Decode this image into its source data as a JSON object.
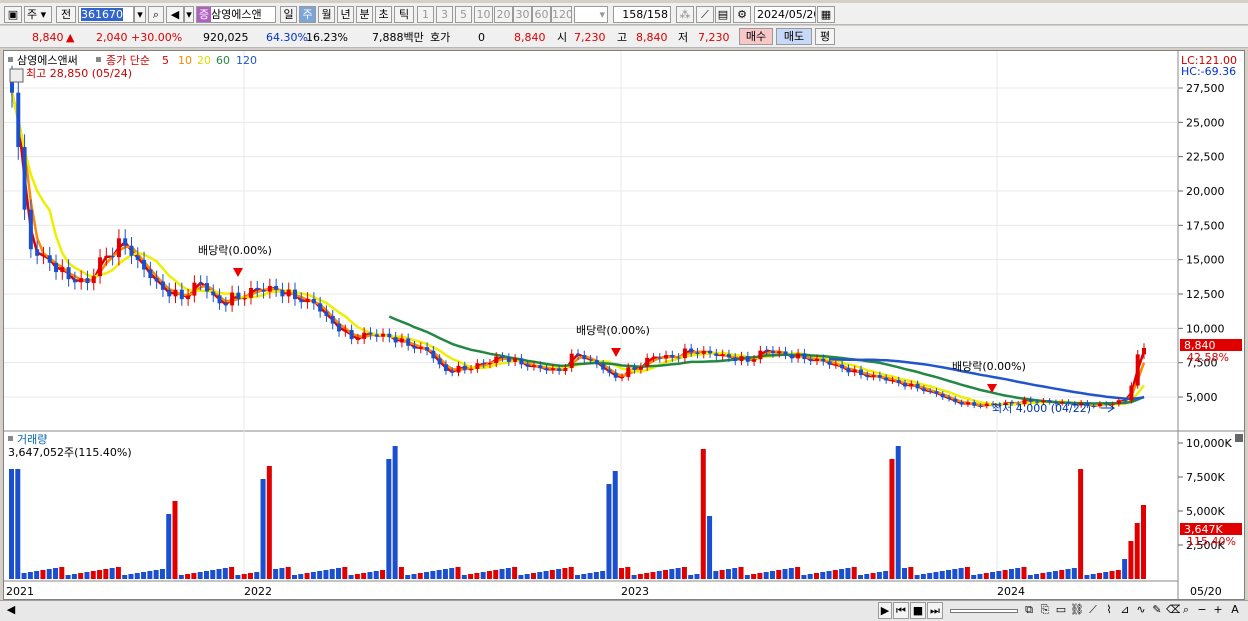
{
  "toolbar": {
    "period_type": "주",
    "prev_label": "전",
    "code": "361670",
    "stock_name": "삼영에스앤",
    "stock_badge": "증",
    "periods": [
      "일",
      "주",
      "월",
      "년",
      "분",
      "초",
      "틱"
    ],
    "active_period": "주",
    "intervals": [
      "1",
      "3",
      "5",
      "10",
      "20",
      "30",
      "60",
      "120"
    ],
    "page_count": "158",
    "page_total": "/158",
    "date": "2024/05/20"
  },
  "quote": {
    "price": "8,840",
    "arrow": "▲",
    "change": "2,040",
    "change_pct": "+30.00%",
    "volume": "920,025",
    "vol_ratio": "64.30%",
    "turnover": "16.23%",
    "amount": "7,888백만",
    "hoga_label": "호가",
    "hoga_value": "0",
    "hoga_price": "8,840",
    "open_label": "시",
    "open": "7,230",
    "high_label": "고",
    "high": "8,840",
    "low_label": "저",
    "low": "7,230",
    "buy_label": "매수",
    "sell_label": "매도",
    "flat_label": "평"
  },
  "chart": {
    "legend_name": "삼영에스앤써",
    "ma_label": "종가 단순",
    "ma_periods": [
      "5",
      "10",
      "20",
      "60",
      "120"
    ],
    "ma_colors": [
      "#dd0000",
      "#ff8800",
      "#eeee00",
      "#228844",
      "#2255cc"
    ],
    "high_annot": "최고 28,850 (05/24)",
    "low_annot": "최저 4,000 (04/22)",
    "dividend_label": "배당락(0.00%)",
    "lc": "LC:121.00",
    "hc": "HC:-69.36",
    "price_ticks": [
      "27,500",
      "25,000",
      "22,500",
      "20,000",
      "17,500",
      "15,000",
      "12,500",
      "10,000",
      "7,500",
      "5,000"
    ],
    "price_tag": "8,840",
    "price_tag_pct": "42.58%",
    "volume_title": "거래량",
    "volume_value": "3,647,052주(115.40%)",
    "volume_ticks": [
      "10,000K",
      "7,500K",
      "5,000K",
      "2,500K"
    ],
    "volume_tag": "3,647K",
    "volume_tag_pct": "115.40%",
    "x_labels": [
      "2021",
      "2022",
      "2023",
      "2024"
    ],
    "x_last": "05/20"
  },
  "colors": {
    "up": "#e00000",
    "down": "#1a4fd0",
    "accent": "#7aa5d6"
  },
  "chart_data": {
    "type": "candlestick",
    "x_years": [
      "2021",
      "2022",
      "2023",
      "2024"
    ],
    "close_approx": [
      28000,
      16000,
      15000,
      14000,
      13500,
      15500,
      16500,
      14500,
      13000,
      12500,
      13500,
      12000,
      12500,
      13000,
      13000,
      12500,
      12000,
      10500,
      9500,
      9700,
      9500,
      9000,
      8500,
      7000,
      7200,
      7500,
      8000,
      7600,
      7200,
      7000,
      8300,
      7500,
      6500,
      7200,
      8000,
      8000,
      8500,
      8300,
      8000,
      7800,
      8500,
      8200,
      8000,
      7700,
      7200,
      6800,
      6500,
      6100,
      5800,
      5300,
      4700,
      4500,
      4500,
      4600,
      4800,
      4700,
      4600,
      4500,
      4500,
      4800,
      8840
    ],
    "ylim": [
      4000,
      29000
    ],
    "volume_max": "10,000K"
  }
}
